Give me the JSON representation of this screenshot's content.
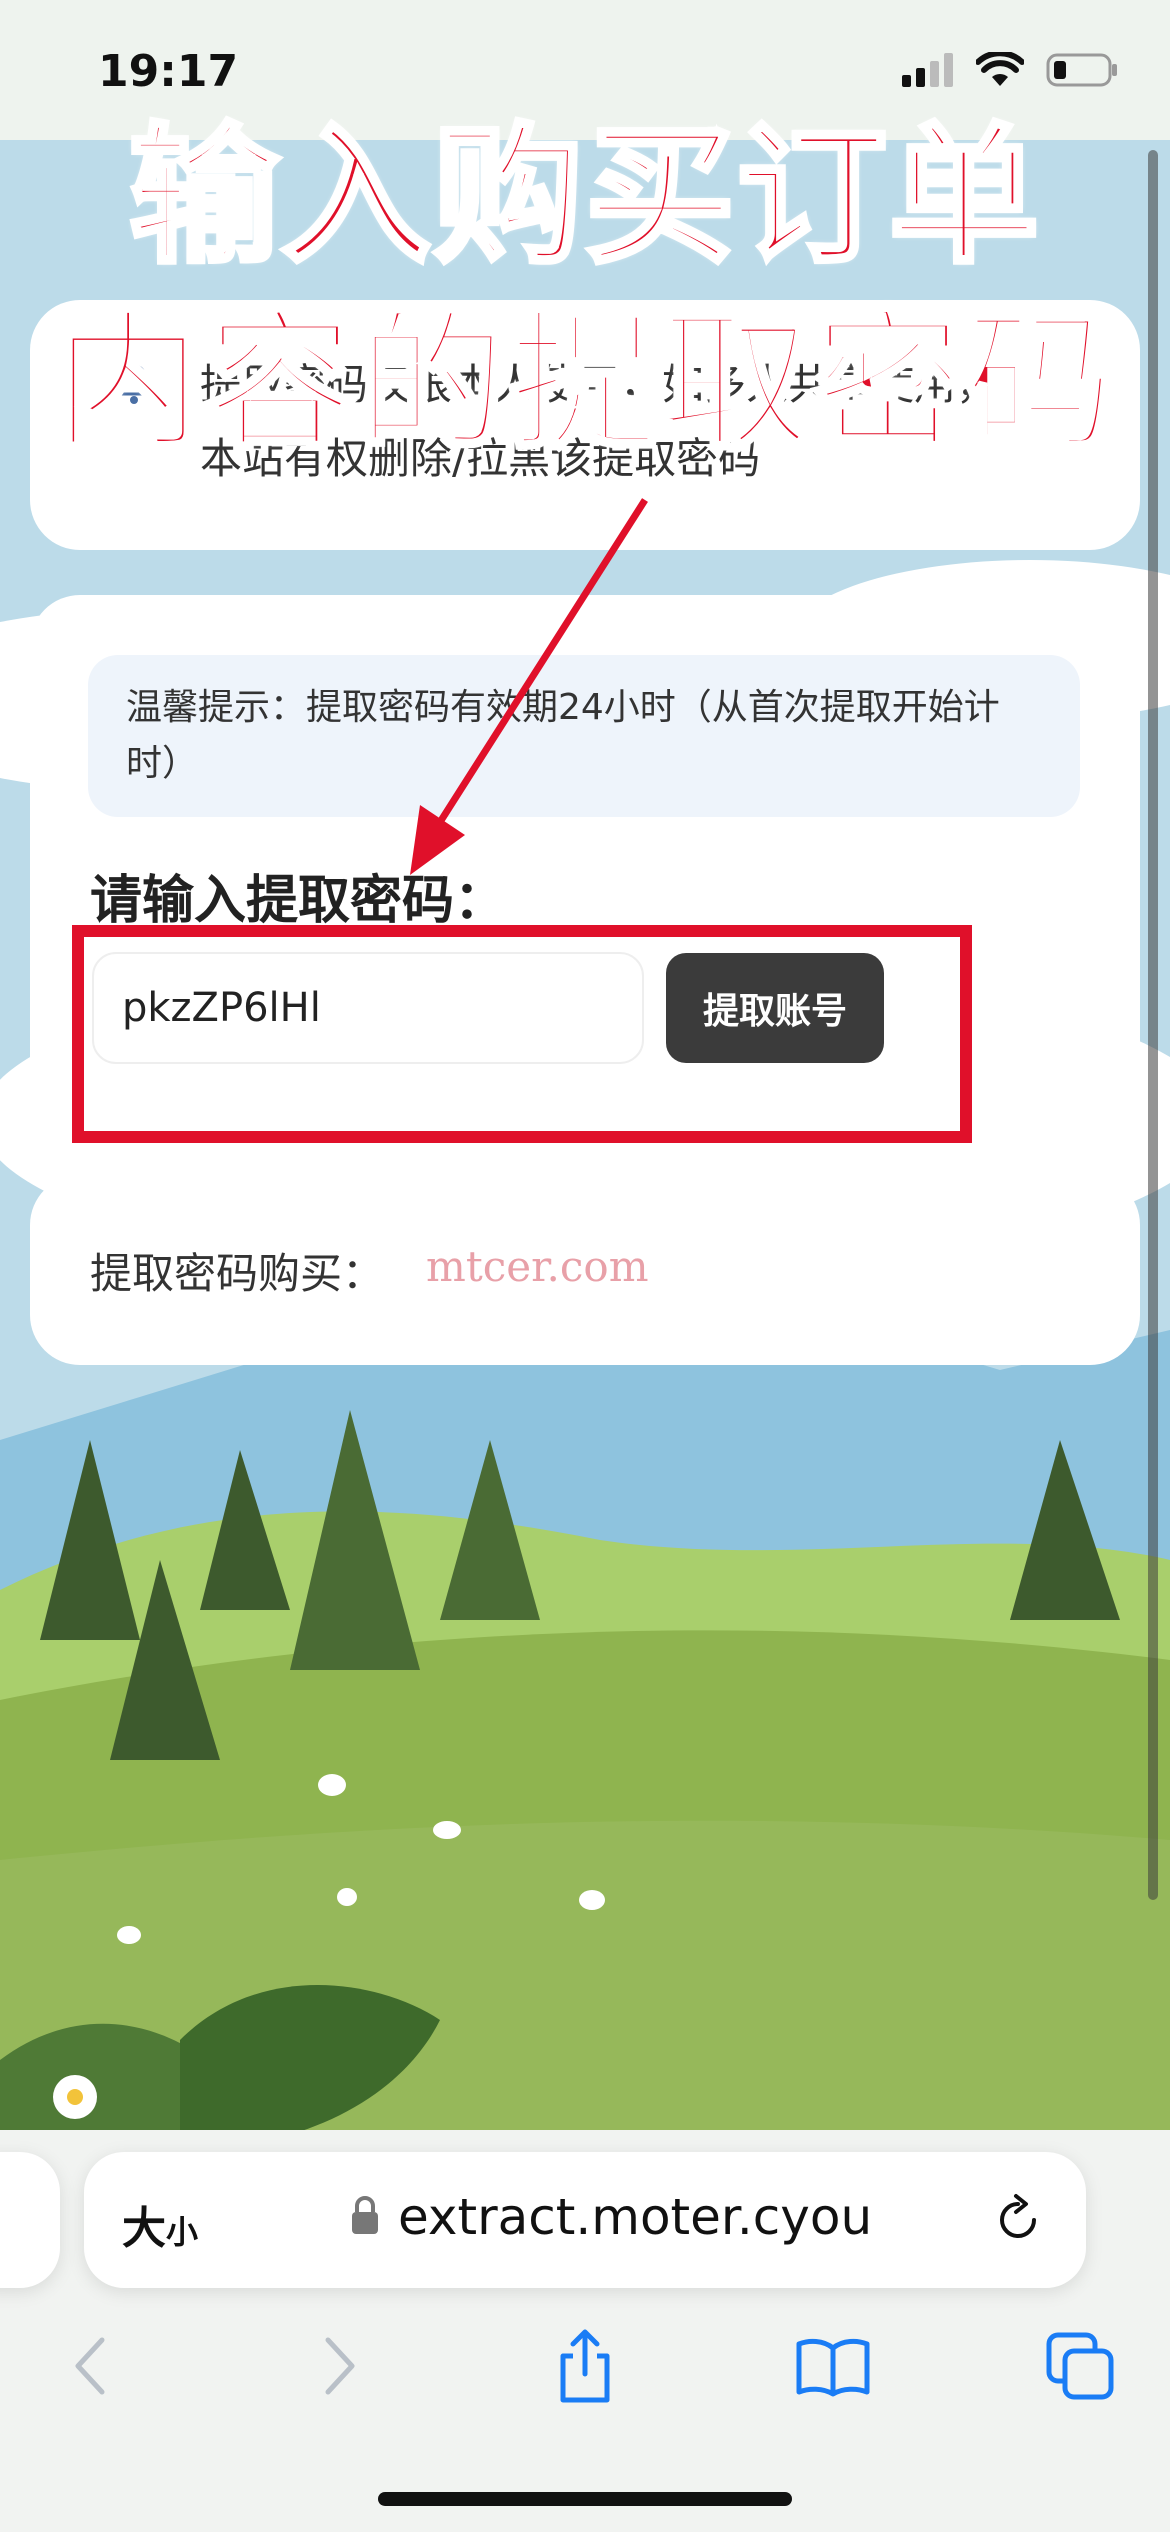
{
  "status_bar": {
    "time": "19:17",
    "icons": [
      "cellular-signal-icon",
      "wifi-icon",
      "battery-icon"
    ]
  },
  "overlay": {
    "headline_line1": "输入购买订单",
    "headline_line2": "内容的提取密码",
    "headline_color": "#e0102a"
  },
  "notice": {
    "icon": "bell-icon",
    "text": "提取密码仅限本人使用，如多人共享使用，本站有权删除/拉黑该提取密码"
  },
  "tip": {
    "text": "温馨提示：提取密码有效期24小时（从首次提取开始计时）"
  },
  "form": {
    "label": "请输入提取密码：",
    "password_value": "pkzZP6lHl",
    "submit_label": "提取账号"
  },
  "purchase": {
    "label": "提取密码购买：",
    "link_text": "mtcer.com",
    "link_color": "#e8a0a8"
  },
  "browser": {
    "text_size_label": "大",
    "text_size_small": "小",
    "url": "extract.moter.cyou",
    "toolbar": [
      "back-icon",
      "forward-icon",
      "share-icon",
      "bookmarks-icon",
      "tabs-icon"
    ]
  }
}
